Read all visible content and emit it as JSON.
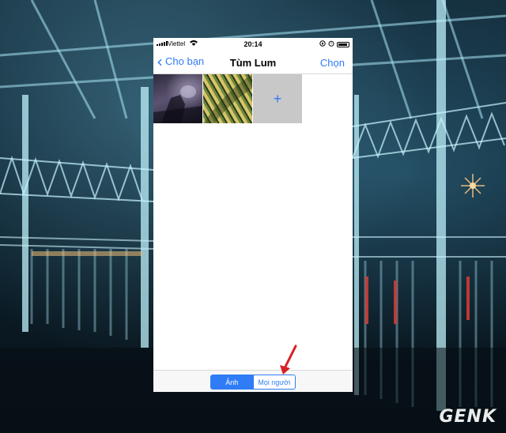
{
  "status_bar": {
    "carrier": "Viettel",
    "time": "20:14"
  },
  "nav": {
    "back_label": "Cho bạn",
    "title": "Tùm Lum",
    "select_label": "Chọn"
  },
  "album": {
    "photos": [
      {
        "name": "photo-1"
      },
      {
        "name": "photo-2"
      }
    ],
    "add_symbol": "+"
  },
  "tabs": {
    "items": [
      {
        "label": "Ảnh",
        "active": true
      },
      {
        "label": "Mọi người",
        "active": false
      }
    ]
  },
  "watermark": {
    "text": "GENK"
  },
  "colors": {
    "accent": "#2f7cf6",
    "arrow": "#d81f26"
  }
}
